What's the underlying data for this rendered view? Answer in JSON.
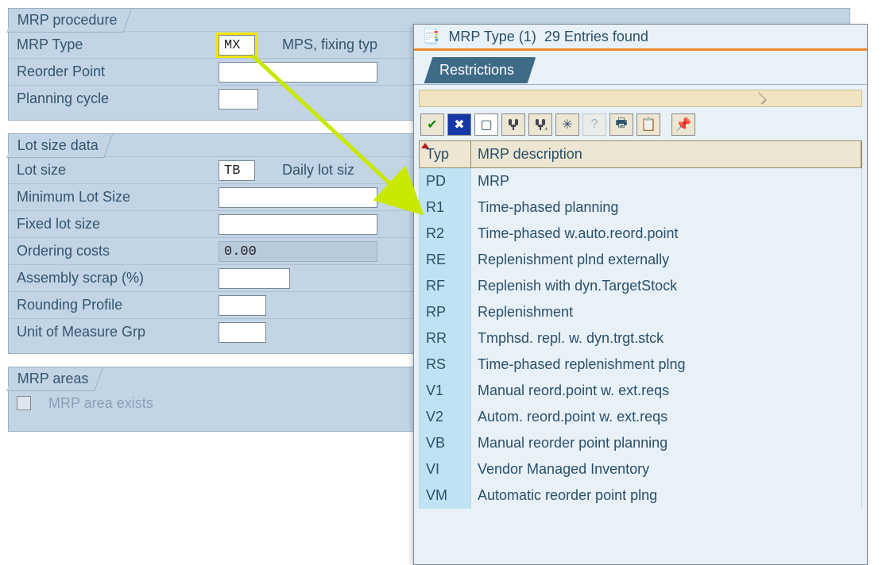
{
  "groups": {
    "mrp_procedure": {
      "title": "MRP procedure",
      "fields": {
        "mrp_type": {
          "label": "MRP Type",
          "value": "MX",
          "desc": "MPS, fixing typ"
        },
        "reorder_point": {
          "label": "Reorder Point",
          "value": ""
        },
        "planning_cycle": {
          "label": "Planning cycle",
          "value": ""
        }
      }
    },
    "lot_size": {
      "title": "Lot size data",
      "fields": {
        "lot_size": {
          "label": "Lot size",
          "value": "TB",
          "desc": "Daily lot siz"
        },
        "min_lot_size": {
          "label": "Minimum Lot Size",
          "value": ""
        },
        "fixed_lot_size": {
          "label": "Fixed lot size",
          "value": ""
        },
        "ordering_costs": {
          "label": "Ordering costs",
          "value": "0.00"
        },
        "assembly_scrap": {
          "label": "Assembly scrap (%)",
          "value": ""
        },
        "rounding_profile": {
          "label": "Rounding Profile",
          "value": ""
        },
        "uom_grp": {
          "label": "Unit of Measure Grp",
          "value": ""
        }
      }
    },
    "mrp_areas": {
      "title": "MRP areas",
      "checkbox_label": "MRP area exists"
    }
  },
  "popup": {
    "title_a": "MRP Type (1)",
    "title_b": "29 Entries found",
    "tab": "Restrictions",
    "columns": {
      "typ": "Typ",
      "desc": "MRP description"
    },
    "rows": [
      {
        "typ": "PD",
        "desc": "MRP"
      },
      {
        "typ": "R1",
        "desc": "Time-phased planning"
      },
      {
        "typ": "R2",
        "desc": "Time-phased w.auto.reord.point"
      },
      {
        "typ": "RE",
        "desc": "Replenishment plnd externally"
      },
      {
        "typ": "RF",
        "desc": "Replenish with dyn.TargetStock"
      },
      {
        "typ": "RP",
        "desc": "Replenishment"
      },
      {
        "typ": "RR",
        "desc": "Tmphsd. repl. w. dyn.trgt.stck"
      },
      {
        "typ": "RS",
        "desc": "Time-phased replenishment plng"
      },
      {
        "typ": "V1",
        "desc": "Manual reord.point w. ext.reqs"
      },
      {
        "typ": "V2",
        "desc": "Autom. reord.point w. ext.reqs"
      },
      {
        "typ": "VB",
        "desc": "Manual reorder point planning"
      },
      {
        "typ": "VI",
        "desc": "Vendor Managed Inventory"
      },
      {
        "typ": "VM",
        "desc": "Automatic reorder point plng"
      }
    ],
    "toolbar_icons": [
      "check",
      "close",
      "new",
      "find",
      "find-next",
      "add-col",
      "help",
      "print",
      "clipboard",
      "pin"
    ]
  }
}
